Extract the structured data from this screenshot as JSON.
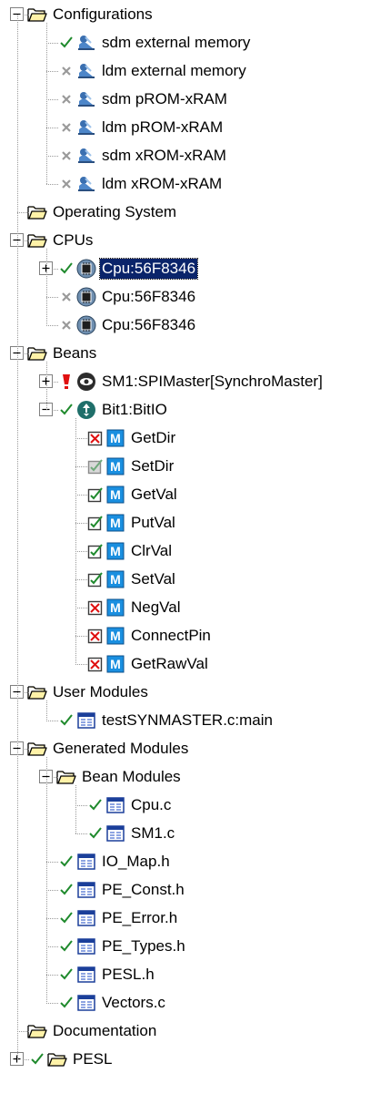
{
  "tree": [
    {
      "level": 0,
      "expander": "minus",
      "icon": "folder-open-icon",
      "label": "Configurations",
      "children": [
        {
          "level": 1,
          "status": "check",
          "icon": "configuration-icon",
          "label": "sdm external memory"
        },
        {
          "level": 1,
          "status": "cross",
          "icon": "configuration-icon",
          "label": "ldm external memory"
        },
        {
          "level": 1,
          "status": "cross",
          "icon": "configuration-icon",
          "label": "sdm pROM-xRAM"
        },
        {
          "level": 1,
          "status": "cross",
          "icon": "configuration-icon",
          "label": "ldm pROM-xRAM"
        },
        {
          "level": 1,
          "status": "cross",
          "icon": "configuration-icon",
          "label": "sdm xROM-xRAM"
        },
        {
          "level": 1,
          "status": "cross",
          "icon": "configuration-icon",
          "label": "ldm xROM-xRAM"
        }
      ]
    },
    {
      "level": 0,
      "expander": "none",
      "icon": "folder-open-icon",
      "label": "Operating System"
    },
    {
      "level": 0,
      "expander": "minus",
      "icon": "folder-open-icon",
      "label": "CPUs",
      "children": [
        {
          "level": 1,
          "expander": "plus",
          "status": "check",
          "icon": "cpu-chip-icon",
          "label": "Cpu:56F8346",
          "selected": true
        },
        {
          "level": 1,
          "status": "cross",
          "icon": "cpu-chip-icon",
          "label": "Cpu:56F8346"
        },
        {
          "level": 1,
          "status": "cross",
          "icon": "cpu-chip-icon",
          "label": "Cpu:56F8346"
        }
      ]
    },
    {
      "level": 0,
      "expander": "minus",
      "icon": "folder-open-icon",
      "label": "Beans",
      "children": [
        {
          "level": 1,
          "expander": "plus",
          "status": "error",
          "icon": "spi-bean-icon",
          "label": "SM1:SPIMaster[SynchroMaster]"
        },
        {
          "level": 1,
          "expander": "minus",
          "status": "check",
          "icon": "bitio-bean-icon",
          "label": "Bit1:BitIO",
          "children": [
            {
              "level": 2,
              "checkbox": "disabled",
              "icon": "method-icon",
              "icon_text": "M",
              "label": "GetDir"
            },
            {
              "level": 2,
              "checkbox": "checked-gray",
              "icon": "method-icon",
              "icon_text": "M",
              "label": "SetDir"
            },
            {
              "level": 2,
              "checkbox": "checked",
              "icon": "method-icon",
              "icon_text": "M",
              "label": "GetVal"
            },
            {
              "level": 2,
              "checkbox": "checked",
              "icon": "method-icon",
              "icon_text": "M",
              "label": "PutVal"
            },
            {
              "level": 2,
              "checkbox": "checked",
              "icon": "method-icon",
              "icon_text": "M",
              "label": "ClrVal"
            },
            {
              "level": 2,
              "checkbox": "checked",
              "icon": "method-icon",
              "icon_text": "M",
              "label": "SetVal"
            },
            {
              "level": 2,
              "checkbox": "disabled",
              "icon": "method-icon",
              "icon_text": "M",
              "label": "NegVal"
            },
            {
              "level": 2,
              "checkbox": "disabled",
              "icon": "method-icon",
              "icon_text": "M",
              "label": "ConnectPin"
            },
            {
              "level": 2,
              "checkbox": "disabled",
              "icon": "method-icon",
              "icon_text": "M",
              "label": "GetRawVal"
            }
          ]
        }
      ]
    },
    {
      "level": 0,
      "expander": "minus",
      "icon": "folder-open-icon",
      "label": "User Modules",
      "children": [
        {
          "level": 1,
          "status": "check",
          "icon": "module-file-icon",
          "label": "testSYNMASTER.c:main"
        }
      ]
    },
    {
      "level": 0,
      "expander": "minus",
      "icon": "folder-open-icon",
      "label": "Generated Modules",
      "children": [
        {
          "level": 1,
          "expander": "minus",
          "icon": "folder-open-icon",
          "label": "Bean Modules",
          "children": [
            {
              "level": 2,
              "status": "check",
              "icon": "module-file-icon",
              "label": "Cpu.c"
            },
            {
              "level": 2,
              "status": "check",
              "icon": "module-file-icon",
              "label": "SM1.c"
            }
          ]
        },
        {
          "level": 1,
          "status": "check",
          "icon": "module-file-icon",
          "label": "IO_Map.h"
        },
        {
          "level": 1,
          "status": "check",
          "icon": "module-file-icon",
          "label": "PE_Const.h"
        },
        {
          "level": 1,
          "status": "check",
          "icon": "module-file-icon",
          "label": "PE_Error.h"
        },
        {
          "level": 1,
          "status": "check",
          "icon": "module-file-icon",
          "label": "PE_Types.h"
        },
        {
          "level": 1,
          "status": "check",
          "icon": "module-file-icon",
          "label": "PESL.h"
        },
        {
          "level": 1,
          "status": "check",
          "icon": "module-file-icon",
          "label": "Vectors.c"
        }
      ]
    },
    {
      "level": 0,
      "expander": "none",
      "icon": "folder-open-icon",
      "label": "Documentation"
    },
    {
      "level": 0,
      "expander": "plus",
      "status": "check",
      "icon": "folder-open-icon",
      "label": "PESL"
    }
  ]
}
